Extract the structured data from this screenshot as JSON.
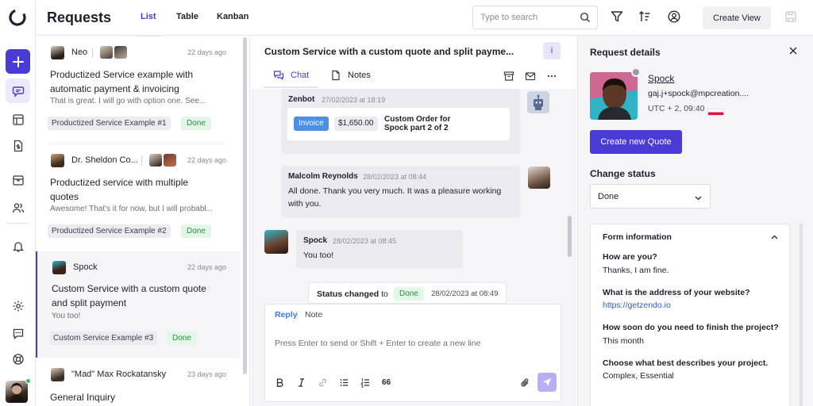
{
  "header": {
    "title": "Requests",
    "tabs": [
      "List",
      "Table",
      "Kanban"
    ],
    "search_placeholder": "Type to search",
    "create_view": "Create View"
  },
  "requests": [
    {
      "name": "Neo",
      "date": "22 days ago",
      "subject": "Productized Service example with automatic payment & invoicing",
      "preview": "That is great. I will go with option one. See...",
      "service": "Productized Service Example #1",
      "status": "Done"
    },
    {
      "name": "Dr. Sheldon Co...",
      "date": "22 days ago",
      "subject": "Productized service with multiple quotes",
      "preview": "Awesome! That's it for now, but I will probabl...",
      "service": "Productized Service Example #2",
      "status": "Done"
    },
    {
      "name": "Spock",
      "date": "22 days ago",
      "subject": "Custom Service with a custom quote and split payment",
      "preview": "You too!",
      "service": "Custom Service Example #3",
      "status": "Done"
    },
    {
      "name": "\"Mad\" Max Rockatansky",
      "date": "23 days ago",
      "subject": "General Inquiry"
    }
  ],
  "conversation": {
    "title": "Custom Service with a custom quote and split payme...",
    "info_label": "i",
    "tabs": [
      "Chat",
      "Notes"
    ],
    "messages": [
      {
        "sender": "Zenbot",
        "time": "27/02/2023 at 18:19",
        "invoice": {
          "badge": "Invoice",
          "amount": "$1,650.00",
          "description": "Custom Order for Spock part 2 of 2"
        }
      },
      {
        "sender": "Malcolm Reynolds",
        "time": "28/02/2023 at 08:44",
        "text": "All done. Thank you very much. It was a pleasure working with you."
      },
      {
        "sender": "Spock",
        "time": "28/02/2023 at 08:45",
        "text": "You too!"
      }
    ],
    "status_change": {
      "label": "Status changed",
      "connector": "to",
      "status": "Done",
      "time": "28/02/2023 at 08:49"
    },
    "composer": {
      "reply": "Reply",
      "note": "Note",
      "placeholder": "Press Enter to send or Shift + Enter to create a new line",
      "quote_glyph": "66"
    }
  },
  "details": {
    "heading": "Request details",
    "client": {
      "name": "Spock",
      "email": "gaj.j+spock@mpcreation....",
      "timezone": "UTC + 2, 09:40"
    },
    "create_quote": "Create new Quote",
    "change_status_label": "Change status",
    "status_value": "Done",
    "form": {
      "title": "Form information",
      "items": [
        {
          "q": "How are you?",
          "a": "Thanks, I am fine."
        },
        {
          "q": "What is the address of your website?",
          "a": "https://getzendo.io"
        },
        {
          "q": "How soon do you need to finish the project?",
          "a": "This month"
        },
        {
          "q": "Choose what best describes your project.",
          "a": "Complex, Essential"
        }
      ]
    }
  },
  "colors": {
    "accent": "#4a3ad6",
    "done_bg": "#e4f6e8",
    "done_text": "#2f8a47",
    "invoice": "#4a8fe8",
    "link": "#2a5cd0"
  }
}
